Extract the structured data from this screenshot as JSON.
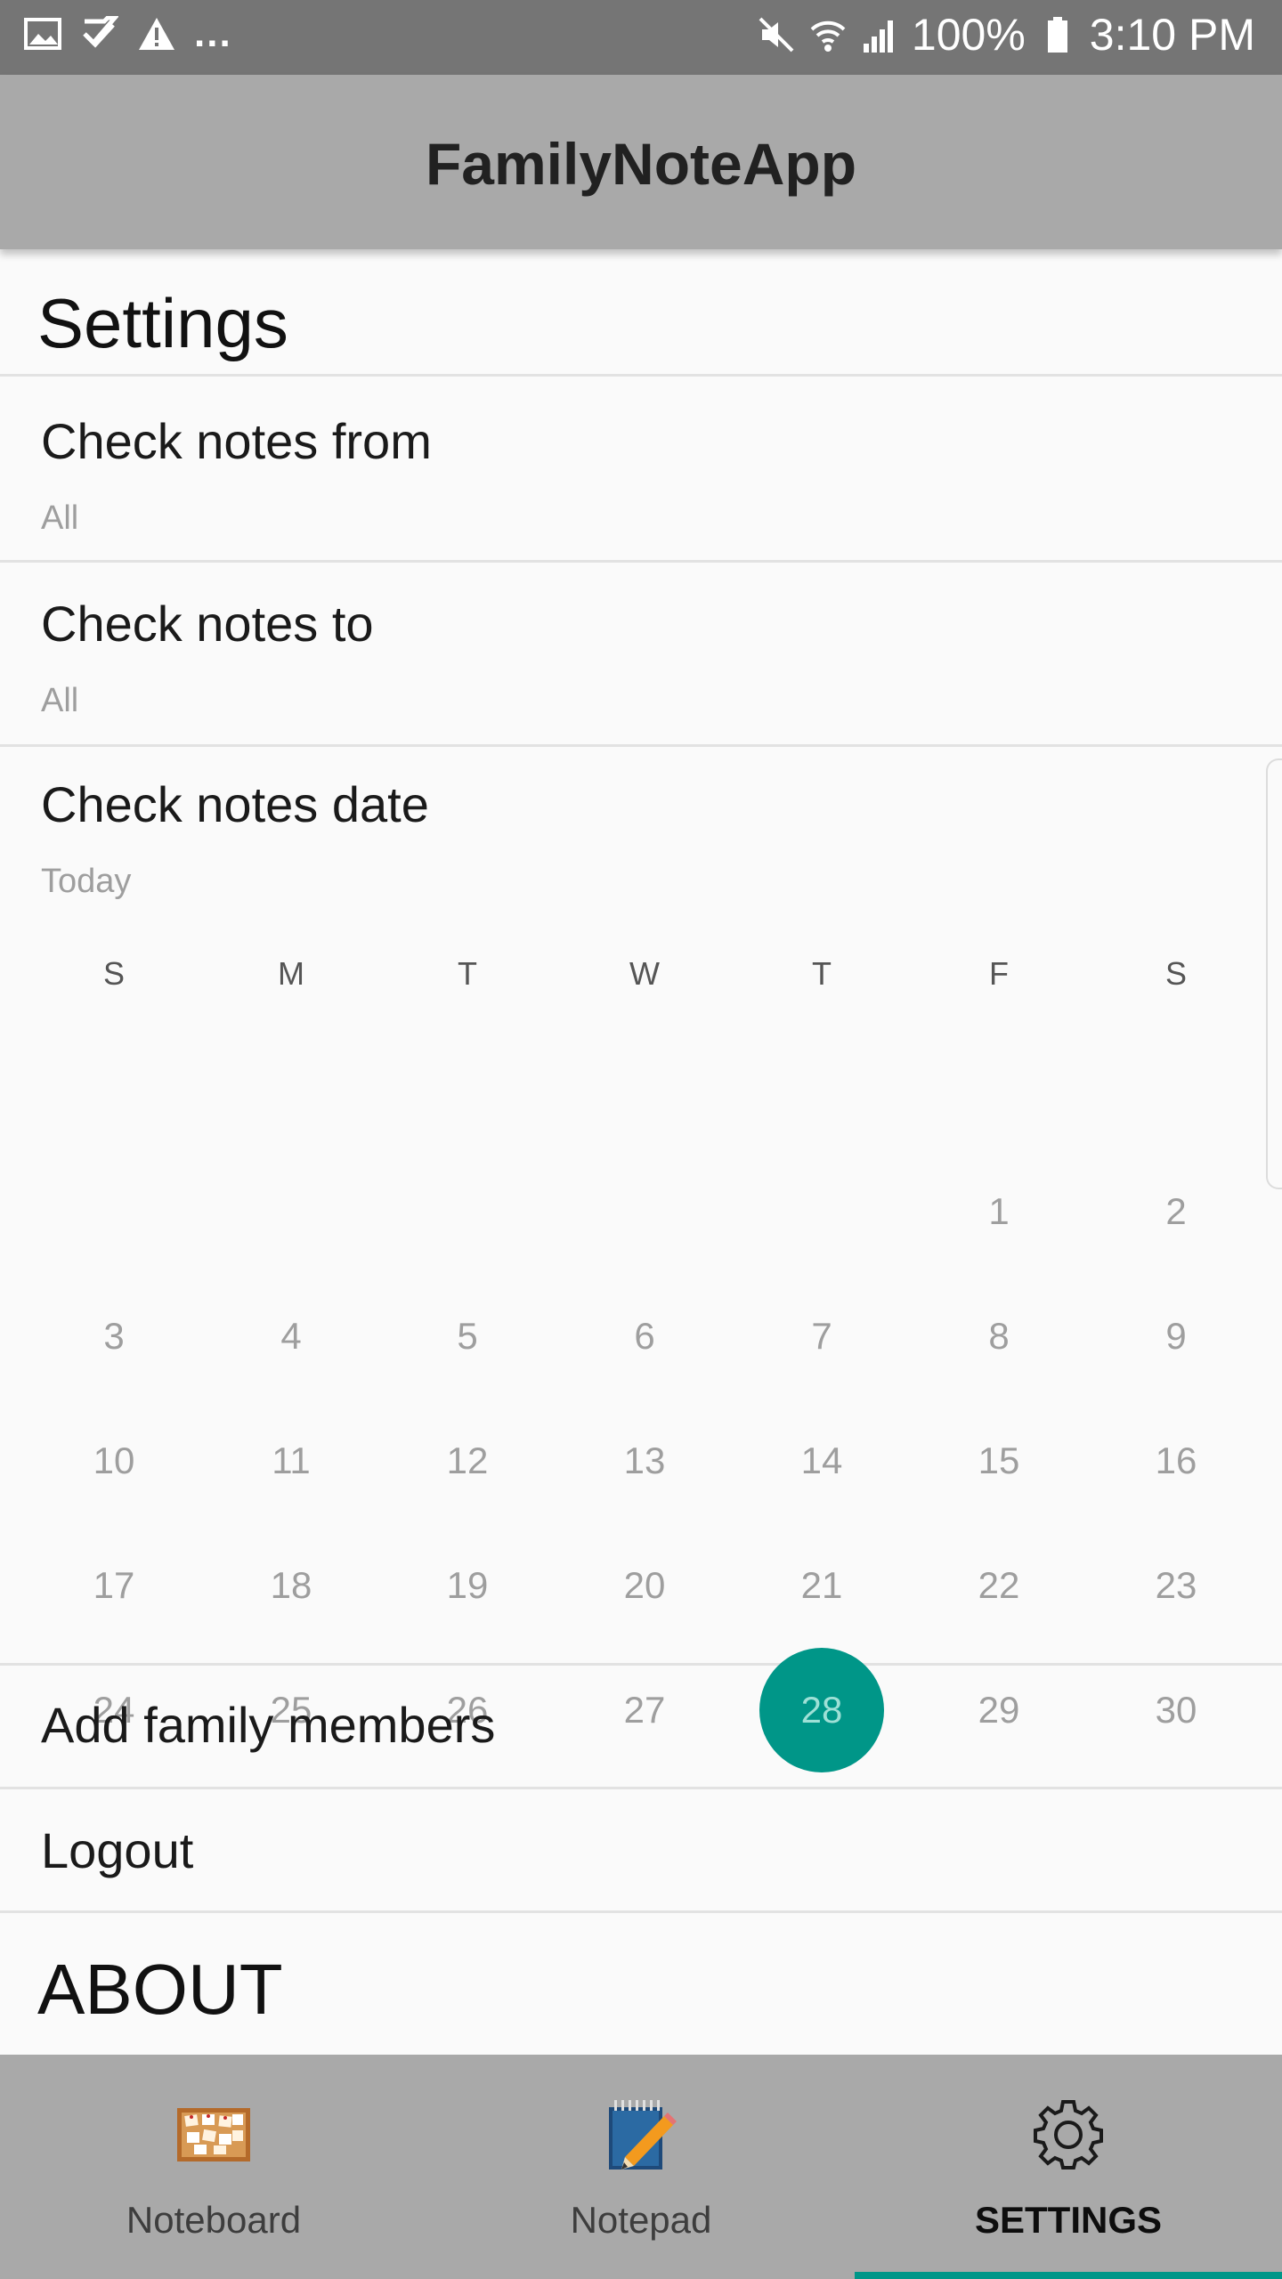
{
  "status_bar": {
    "left_icons": [
      "image-icon",
      "checklist-icon",
      "warning-icon"
    ],
    "overflow": "...",
    "right_icons": [
      "mute-icon",
      "wifi-icon",
      "signal-icon"
    ],
    "battery": "100%",
    "time": "3:10 PM"
  },
  "app_bar": {
    "title": "FamilyNoteApp"
  },
  "settings": {
    "header": "Settings",
    "check_from": {
      "title": "Check notes from",
      "value": "All"
    },
    "check_to": {
      "title": "Check notes to",
      "value": "All"
    },
    "check_date": {
      "title": "Check notes date",
      "value": "Today"
    },
    "calendar": {
      "weekdays": [
        "S",
        "M",
        "T",
        "W",
        "T",
        "F",
        "S"
      ],
      "first_weekday_index": 5,
      "days_in_month": 30,
      "selected_day": 28,
      "accent_color": "#009688"
    },
    "add_family": "Add family members",
    "logout": "Logout",
    "about": "ABOUT"
  },
  "bottom_nav": {
    "tabs": [
      {
        "label": "Noteboard",
        "icon": "corkboard-icon",
        "active": false
      },
      {
        "label": "Notepad",
        "icon": "notepad-pencil-icon",
        "active": false
      },
      {
        "label": "SETTINGS",
        "icon": "gear-icon",
        "active": true
      }
    ]
  }
}
